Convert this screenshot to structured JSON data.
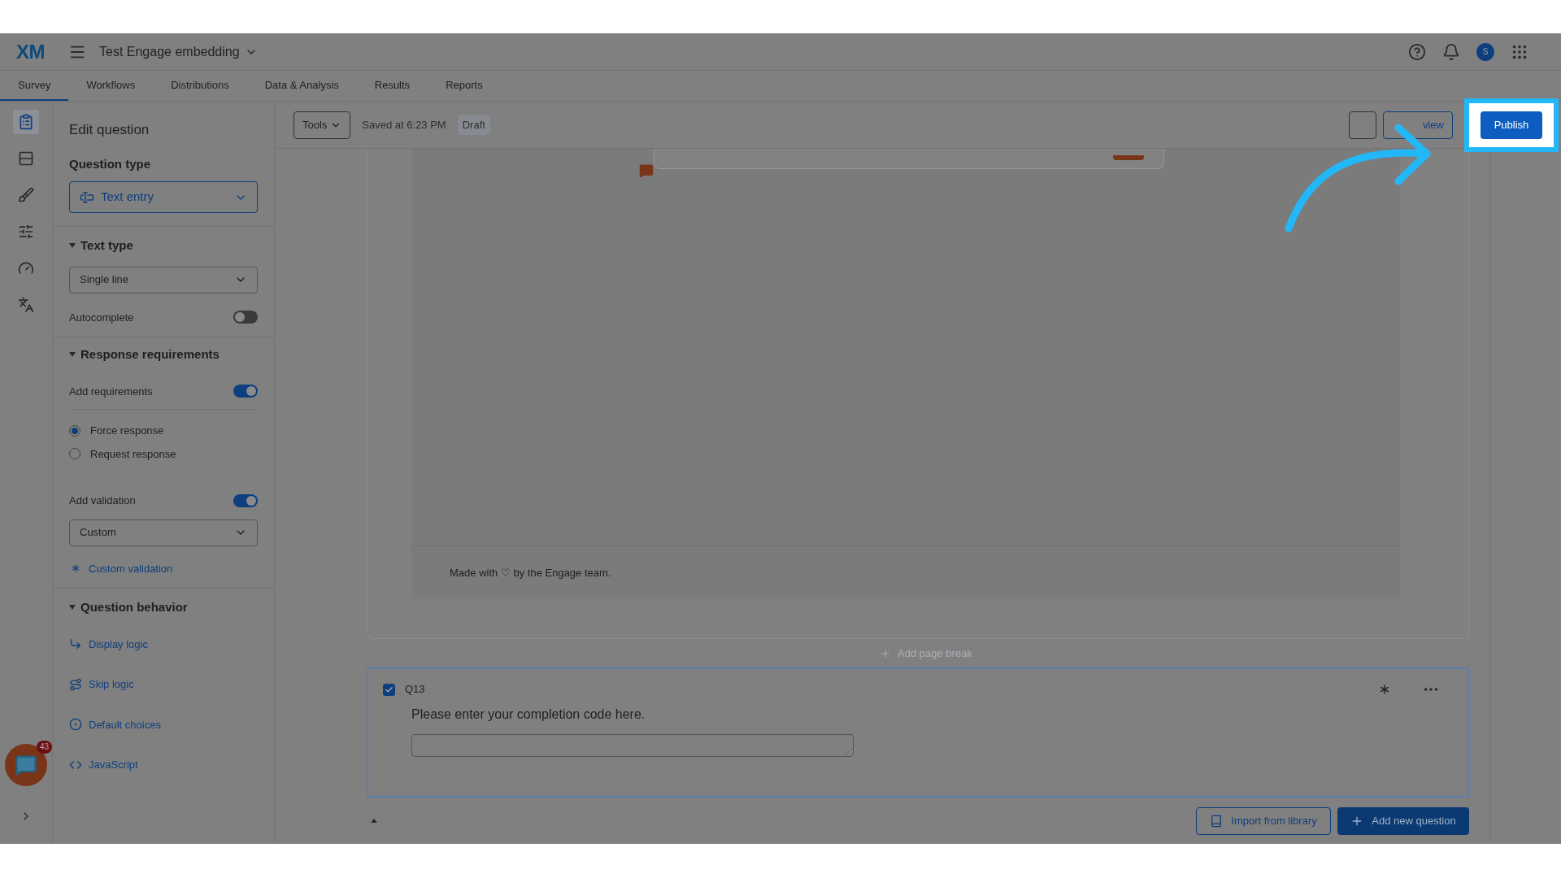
{
  "header": {
    "logo": "XM",
    "survey_title": "Test Engage embedding",
    "avatar": "S"
  },
  "tabs": [
    {
      "label": "Survey",
      "selected": true
    },
    {
      "label": "Workflows",
      "selected": false
    },
    {
      "label": "Distributions",
      "selected": false
    },
    {
      "label": "Data & Analysis",
      "selected": false
    },
    {
      "label": "Results",
      "selected": false
    },
    {
      "label": "Reports",
      "selected": false
    }
  ],
  "rail": [
    {
      "selected": true
    },
    {
      "selected": false
    },
    {
      "selected": false
    },
    {
      "selected": false
    },
    {
      "selected": false
    },
    {
      "selected": false
    }
  ],
  "edit_panel": {
    "title": "Edit question",
    "question_type_heading": "Question type",
    "question_type": "Text entry",
    "text_type_heading": "Text type",
    "text_type": "Single line",
    "autocomplete": {
      "label": "Autocomplete",
      "on": false
    },
    "requirements_heading": "Response requirements",
    "add_requirements": {
      "label": "Add requirements",
      "on": true
    },
    "radios": [
      {
        "label": "Force response",
        "selected": true
      },
      {
        "label": "Request response",
        "selected": false
      }
    ],
    "add_validation": {
      "label": "Add validation",
      "on": true
    },
    "validation_type": "Custom",
    "custom_validation": "Custom validation",
    "behavior_heading": "Question behavior",
    "behavior_links": [
      "Display logic",
      "Skip logic",
      "Default choices",
      "JavaScript"
    ]
  },
  "chat_badge": "43",
  "toolbar": {
    "tools": "Tools",
    "saved": "Saved at 6:23 PM",
    "status": "Draft",
    "preview": "view",
    "publish": "Publish"
  },
  "canvas": {
    "footer": "Made with ♡ by the Engage team.",
    "add_page_break": "Add page break",
    "question": {
      "number": "Q13",
      "checked": true,
      "text": "Please enter your completion code here."
    },
    "import_button": "Import from library",
    "add_button": "Add new question"
  }
}
